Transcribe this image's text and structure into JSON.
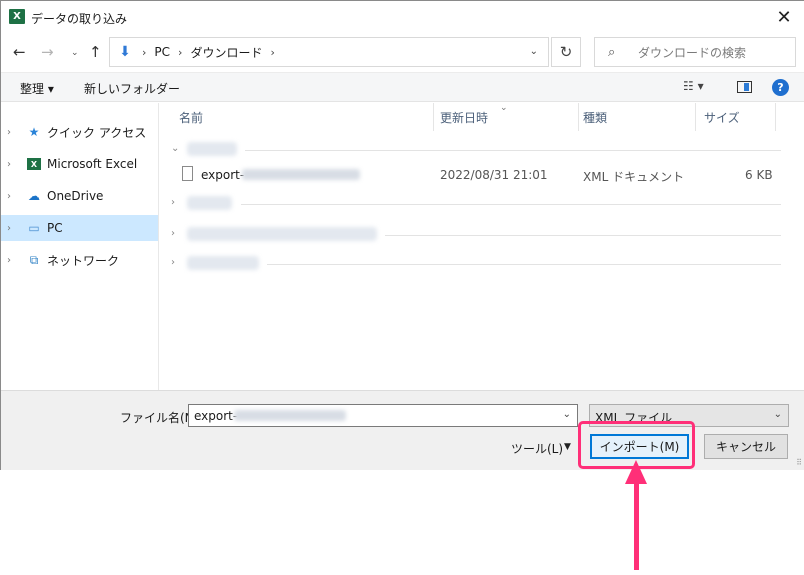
{
  "window": {
    "title": "データの取り込み",
    "app_icon": "excel-icon",
    "close_glyph": "✕"
  },
  "address_bar": {
    "back_glyph": "←",
    "forward_glyph": "→",
    "recent_glyph": "⌄",
    "up_glyph": "↑",
    "location_icon": "download-icon",
    "separator": "›",
    "path": [
      "PC",
      "ダウンロード"
    ],
    "refresh_glyph": "↻",
    "search_placeholder": "ダウンロードの検索"
  },
  "toolbar": {
    "organize_label": "整理 ▾",
    "new_folder_label": "新しいフォルダー",
    "view_glyph": "☷ ▾",
    "help_glyph": "?"
  },
  "sidebar": {
    "items": [
      {
        "label": "クイック アクセス",
        "icon": "star-icon",
        "glyph": "★"
      },
      {
        "label": "Microsoft Excel",
        "icon": "excel-icon",
        "glyph": "X"
      },
      {
        "label": "OneDrive",
        "icon": "cloud-icon",
        "glyph": "☁"
      },
      {
        "label": "PC",
        "icon": "computer-icon",
        "glyph": "🖳"
      },
      {
        "label": "ネットワーク",
        "icon": "network-icon",
        "glyph": "⧉"
      }
    ],
    "selected_index": 3,
    "expand_glyph": "›"
  },
  "file_list": {
    "columns": [
      "名前",
      "更新日時",
      "種類",
      "サイズ"
    ],
    "sort_glyph": "⌄",
    "files": [
      {
        "name": "export-",
        "modified": "2022/08/31 21:01",
        "type": "XML ドキュメント",
        "size": "6 KB"
      }
    ]
  },
  "footer": {
    "filename_label": "ファイル名(N):",
    "filename_value": "export-",
    "filetype_value": "XML ファイル",
    "tools_label": "ツール(L)",
    "tools_caret": "▼",
    "import_label": "インポート(M)",
    "cancel_label": "キャンセル"
  },
  "annotation": {
    "highlight_color": "#ff2f78"
  },
  "colors": {
    "accent": "#0078d7",
    "selected_bg": "#cce8ff",
    "excel_green": "#1e7145"
  }
}
